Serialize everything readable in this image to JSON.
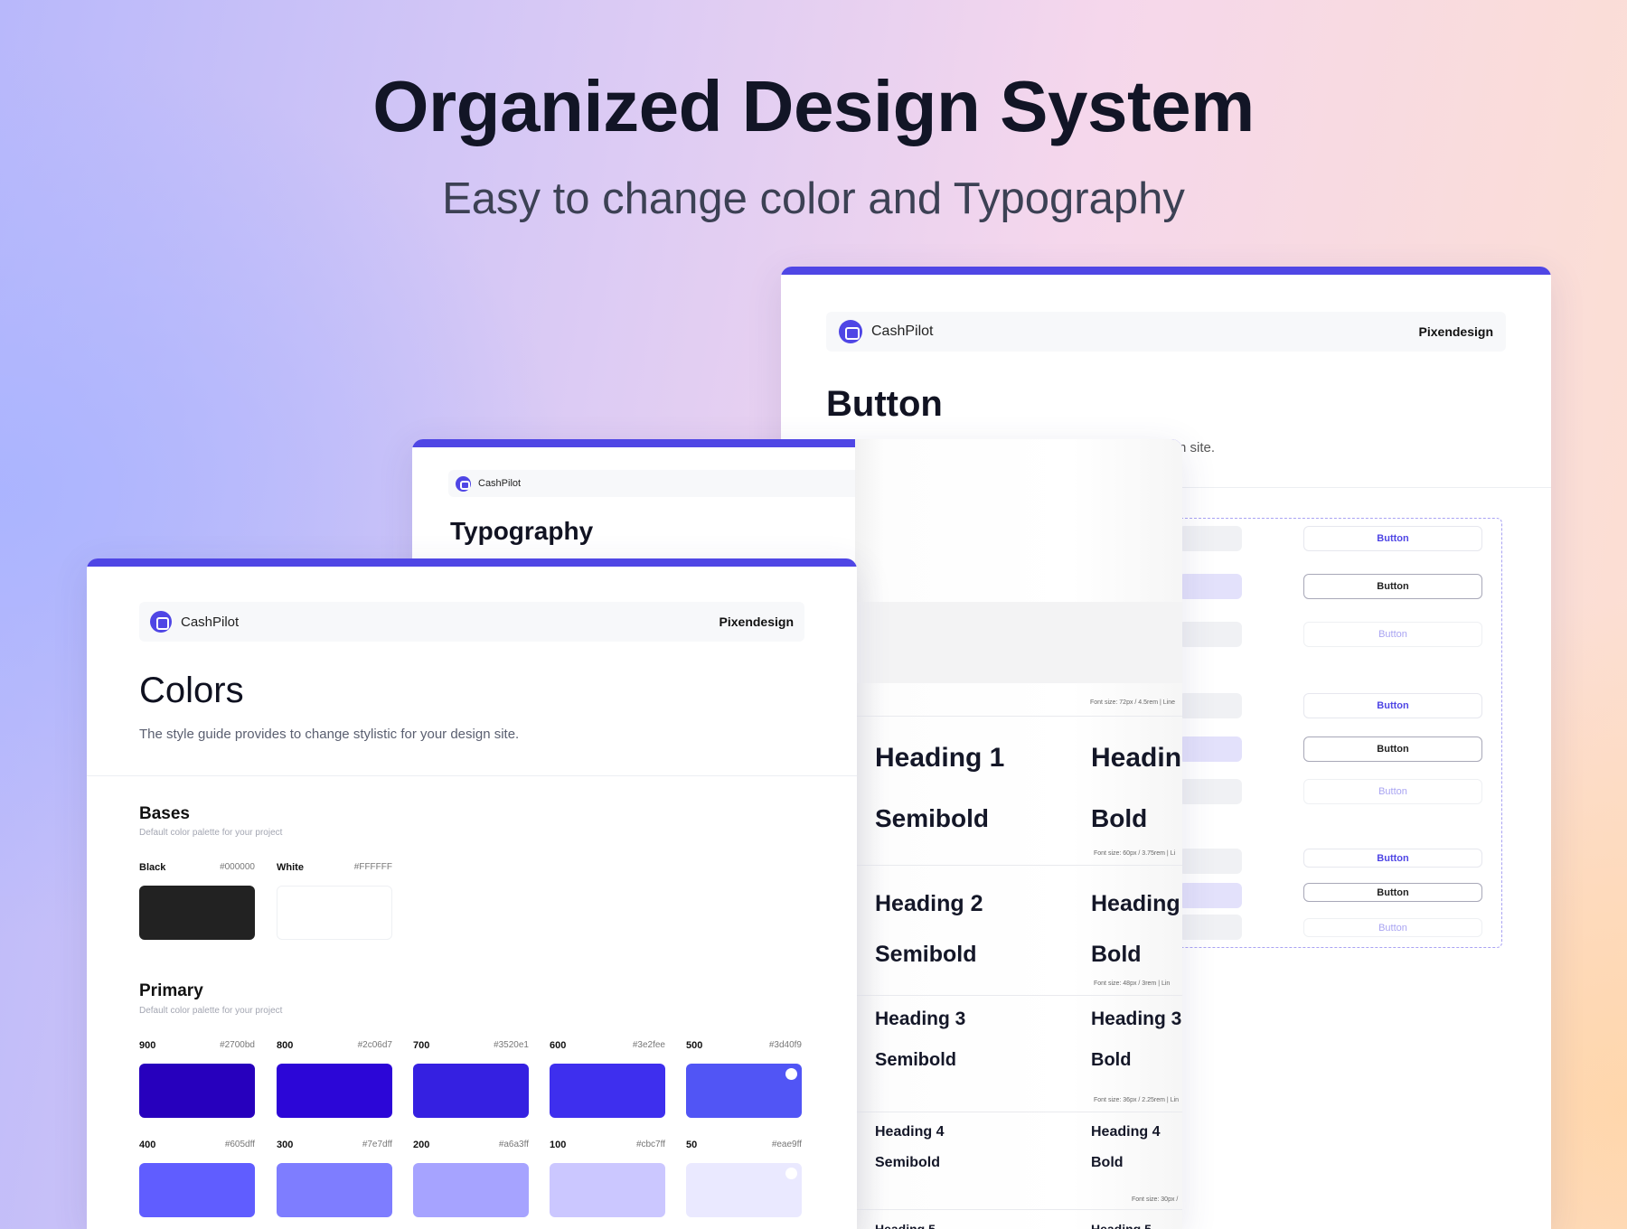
{
  "hero": {
    "title": "Organized Design System",
    "subtitle": "Easy to change color and Typography"
  },
  "button_card": {
    "brand": "CashPilot",
    "studio": "Pixendesign",
    "title": "Button",
    "desc_tail": "n site.",
    "button_label": "Button"
  },
  "typography_card": {
    "brand": "CashPilot",
    "title": "Typography",
    "rows": [
      {
        "meta": "Font size: 72px / 4.5rem | Line",
        "name_a": "Heading 1",
        "weight_a": "Semibold",
        "name_b": "Headin",
        "weight_b": "Bold"
      },
      {
        "meta": "Font size: 60px / 3.75rem | Li",
        "name_a": "Heading 2",
        "weight_a": "Semibold",
        "name_b": "Heading",
        "weight_b": "Bold"
      },
      {
        "meta": "Font size: 48px / 3rem | Lin",
        "name_a": "Heading 3",
        "weight_a": "Semibold",
        "name_b": "Heading 3",
        "weight_b": "Bold"
      },
      {
        "meta": "Font size: 36px / 2.25rem | Lin",
        "name_a": "Heading 4",
        "weight_a": "Semibold",
        "name_b": "Heading 4",
        "weight_b": "Bold"
      },
      {
        "meta": "Font size: 30px /",
        "name_a": "Heading 5",
        "weight_a": "",
        "name_b": "Heading 5",
        "weight_b": ""
      }
    ]
  },
  "colors_card": {
    "brand": "CashPilot",
    "studio": "Pixendesign",
    "title": "Colors",
    "desc": "The style guide provides to change stylistic for your design site.",
    "bases": {
      "title": "Bases",
      "subtitle": "Default color palette for your project",
      "swatches": [
        {
          "label": "Black",
          "hex": "#000000",
          "color": "#222222"
        },
        {
          "label": "White",
          "hex": "#FFFFFF",
          "color": "#ffffff"
        }
      ]
    },
    "primary": {
      "title": "Primary",
      "subtitle": "Default color palette for your project",
      "swatches": [
        {
          "label": "900",
          "hex": "#2700bd",
          "color": "#2700bd"
        },
        {
          "label": "800",
          "hex": "#2c06d7",
          "color": "#2c06d7"
        },
        {
          "label": "700",
          "hex": "#3520e1",
          "color": "#3520e1"
        },
        {
          "label": "600",
          "hex": "#3e2fee",
          "color": "#3e2fee"
        },
        {
          "label": "500",
          "hex": "#3d40f9",
          "color": "#5155f5"
        },
        {
          "label": "400",
          "hex": "#605dff",
          "color": "#605dff"
        },
        {
          "label": "300",
          "hex": "#7e7dff",
          "color": "#7e7dff"
        },
        {
          "label": "200",
          "hex": "#a6a3ff",
          "color": "#a6a3ff"
        },
        {
          "label": "100",
          "hex": "#cbc7ff",
          "color": "#cbc7ff"
        },
        {
          "label": "50",
          "hex": "#eae9ff",
          "color": "#eae9ff"
        }
      ]
    }
  }
}
